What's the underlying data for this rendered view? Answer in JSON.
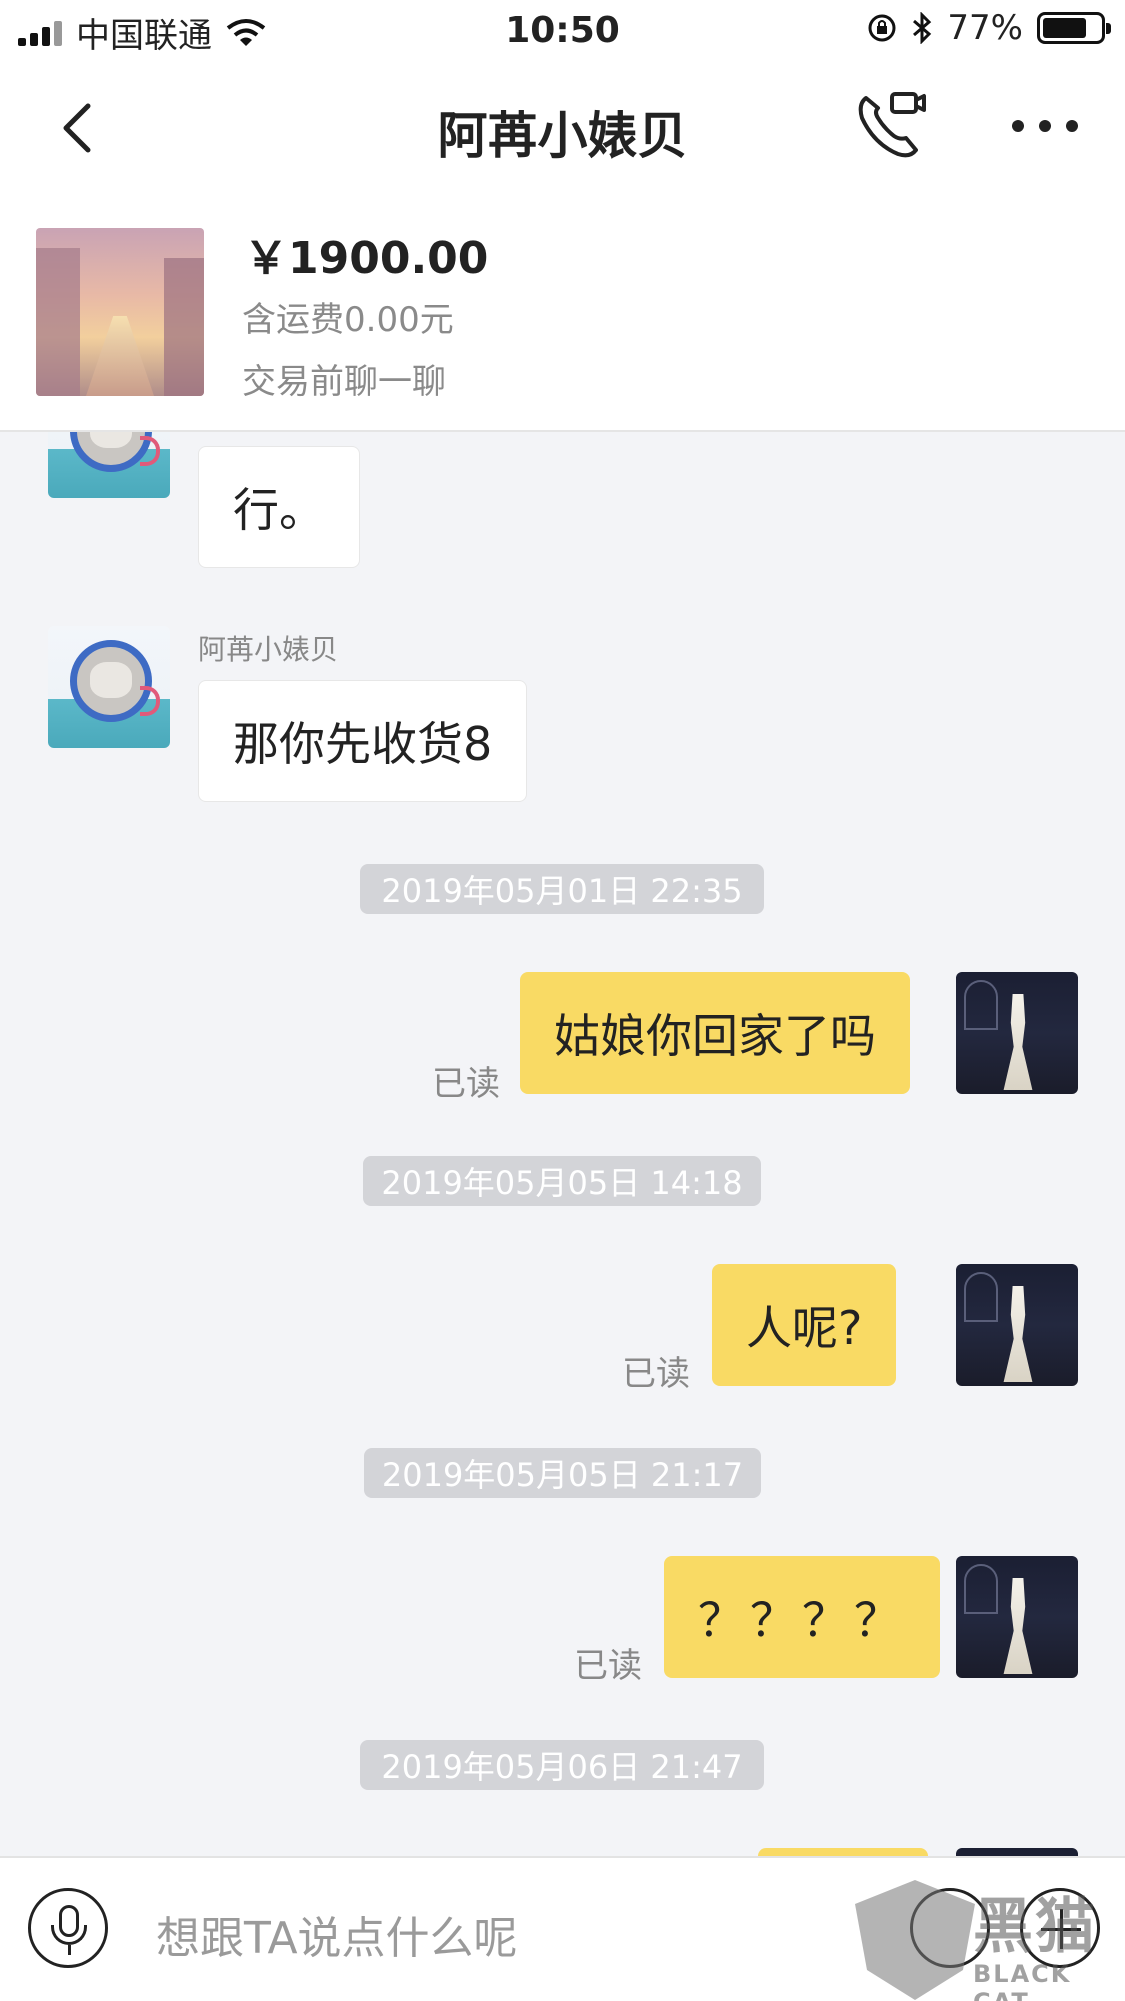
{
  "status_bar": {
    "carrier": "中国联通",
    "time": "10:50",
    "battery_percent": "77%",
    "battery_level": 0.77,
    "icons": [
      "signal-icon",
      "wifi-icon",
      "orientation-lock-icon",
      "bluetooth-icon",
      "battery-icon"
    ]
  },
  "header": {
    "title": "阿苒小婊贝",
    "icons": [
      "back-arrow-icon",
      "phone-video-icon",
      "more-icon"
    ]
  },
  "product": {
    "price": "￥1900.00",
    "shipping": "含运费0.00元",
    "status": "交易前聊一聊"
  },
  "messages": [
    {
      "direction": "in",
      "text": "行。"
    },
    {
      "direction": "in",
      "sender": "阿苒小婊贝",
      "text": "那你先收货8"
    },
    {
      "timestamp": "2019年05月01日 22:35"
    },
    {
      "direction": "out",
      "text": "姑娘你回家了吗",
      "status": "已读"
    },
    {
      "timestamp": "2019年05月05日 14:18"
    },
    {
      "direction": "out",
      "text": "人呢?",
      "status": "已读"
    },
    {
      "timestamp": "2019年05月05日 21:17"
    },
    {
      "direction": "out",
      "text": "？？？？",
      "status": "已读"
    },
    {
      "timestamp": "2019年05月06日 21:47"
    }
  ],
  "input_bar": {
    "placeholder": "想跟TA说点什么呢",
    "icons": [
      "microphone-icon",
      "emoji-icon",
      "plus-icon"
    ]
  },
  "watermark": {
    "cn": "黑猫",
    "en": "BLACK CAT"
  },
  "colors": {
    "outgoing_bubble": "#f9da64",
    "incoming_bubble": "#ffffff",
    "chat_background": "#f3f4f7",
    "timestamp_pill": "#d3d4d8"
  }
}
